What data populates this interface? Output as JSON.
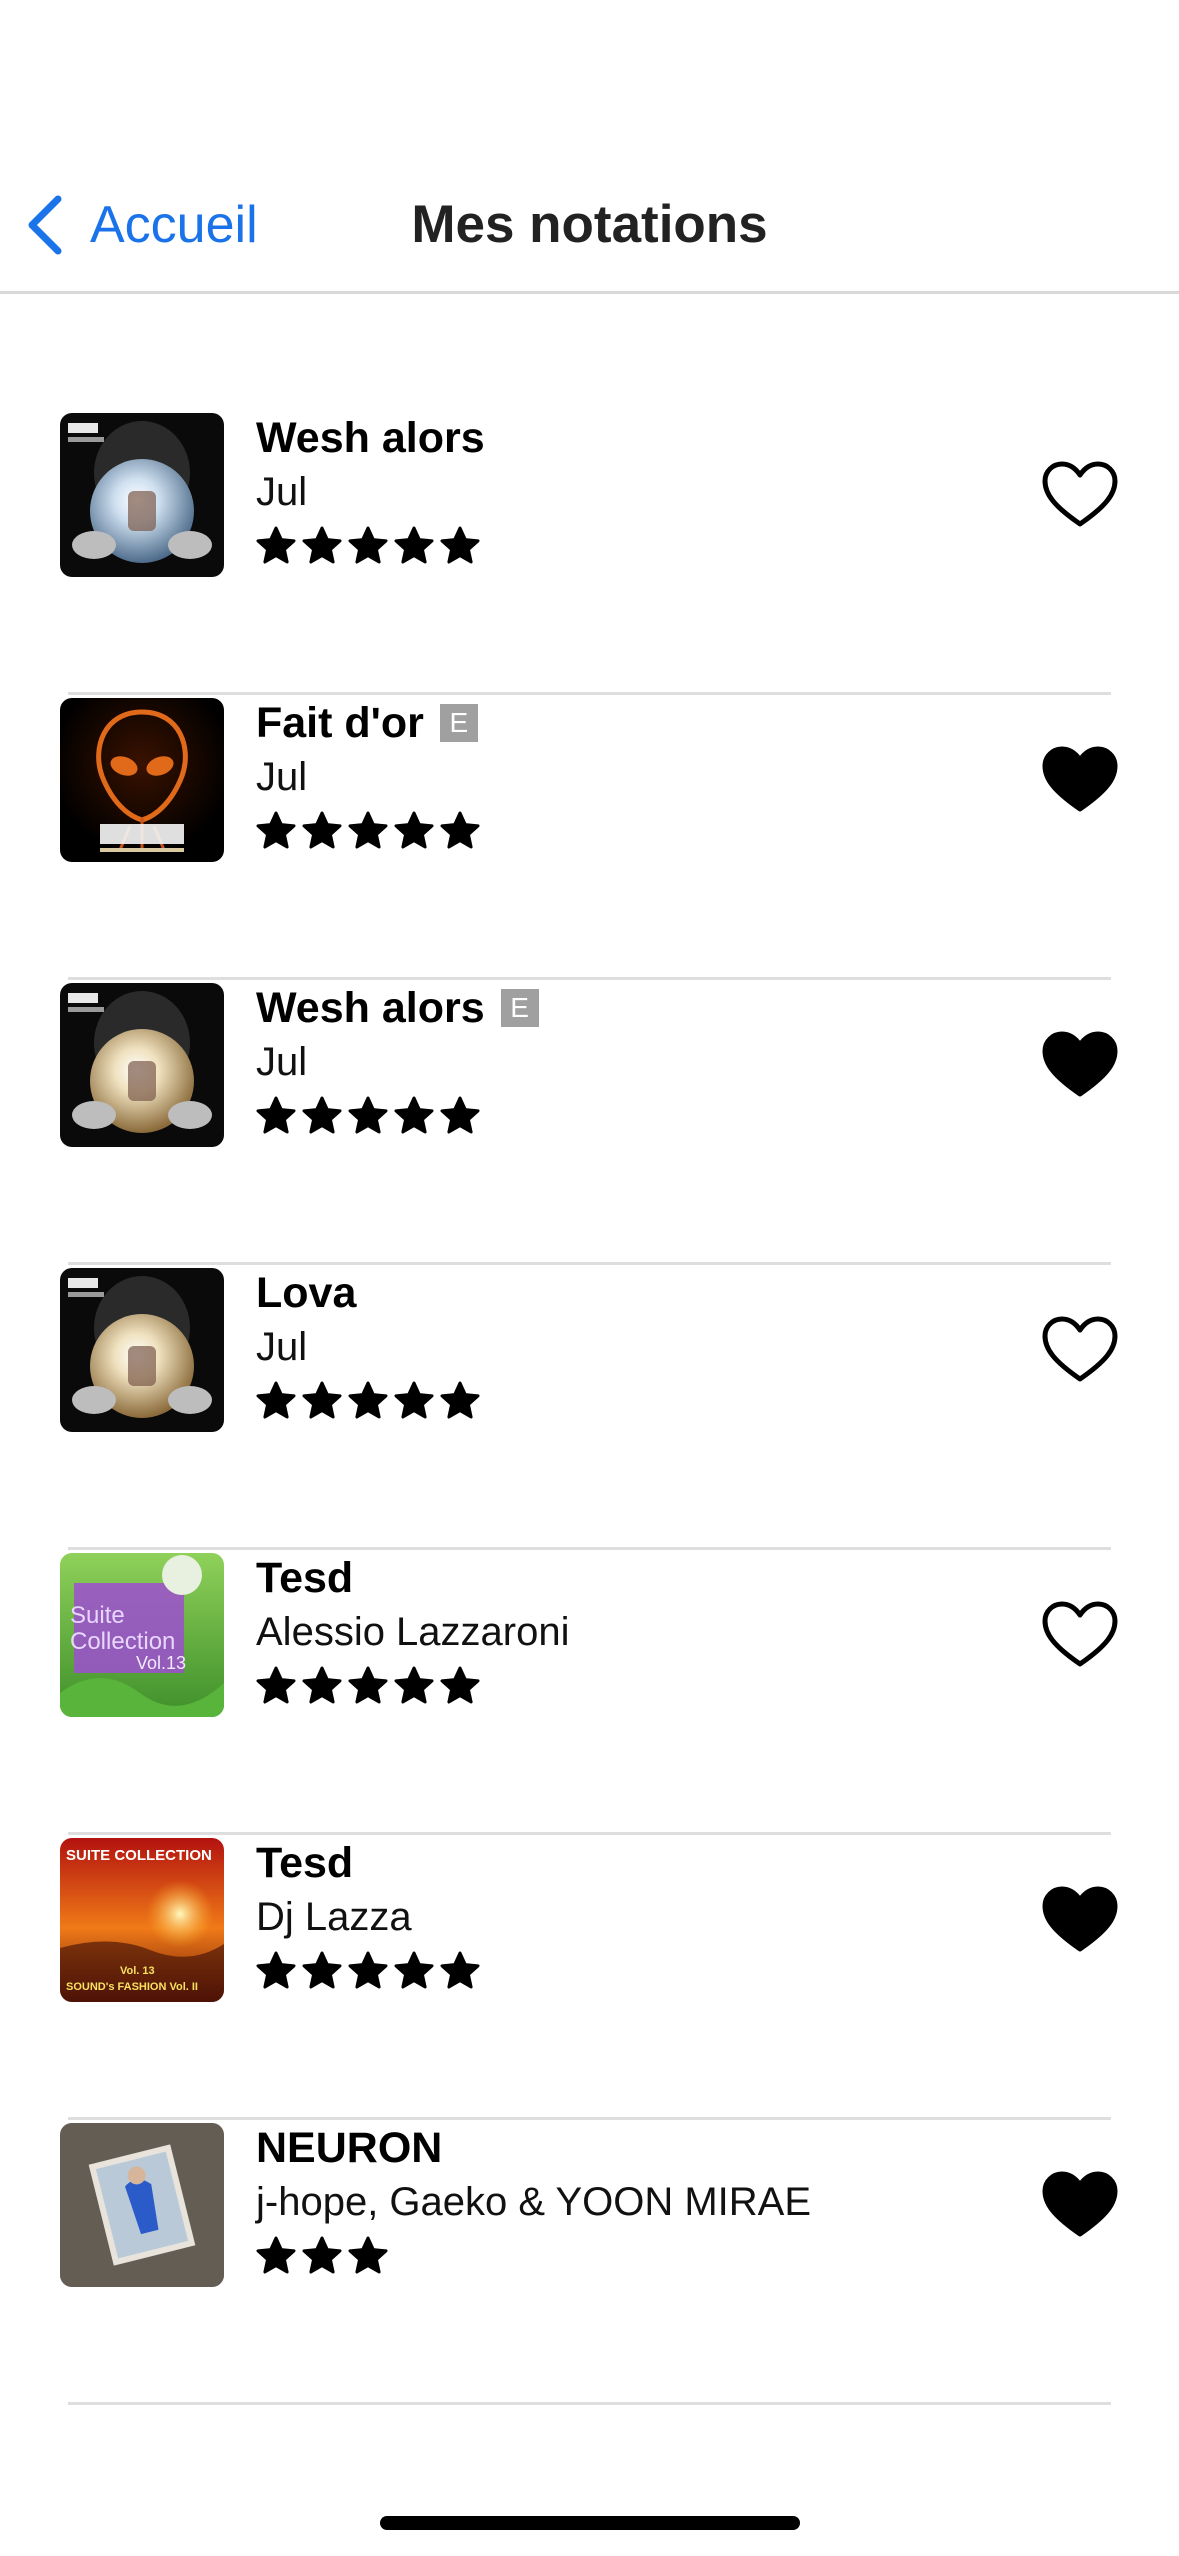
{
  "nav": {
    "back_label": "Accueil",
    "title": "Mes notations"
  },
  "accent_color": "#1a73e8",
  "items": [
    {
      "title": "Wesh alors",
      "explicit": false,
      "artist": "Jul",
      "rating": 5,
      "liked": false,
      "cover": "jul-crystal-ball-blue"
    },
    {
      "title": "Fait d'or",
      "explicit": true,
      "explicit_label": "E",
      "artist": "Jul",
      "rating": 5,
      "liked": true,
      "cover": "jul-alien-orange"
    },
    {
      "title": "Wesh alors",
      "explicit": true,
      "explicit_label": "E",
      "artist": "Jul",
      "rating": 5,
      "liked": true,
      "cover": "jul-crystal-ball-gold"
    },
    {
      "title": "Lova",
      "explicit": false,
      "artist": "Jul",
      "rating": 5,
      "liked": false,
      "cover": "jul-crystal-ball-gold"
    },
    {
      "title": "Tesd",
      "explicit": false,
      "artist": "Alessio Lazzaroni",
      "rating": 5,
      "liked": false,
      "cover": "suite-collection-green",
      "cover_text": "Suite Collection Vol.13"
    },
    {
      "title": "Tesd",
      "explicit": false,
      "artist": "Dj Lazza",
      "rating": 5,
      "liked": true,
      "cover": "suite-collection-sunset",
      "cover_text": "SUITE COLLECTION",
      "cover_subtext": "Vol. 13 SOUND's FASHION Vol. II"
    },
    {
      "title": "NEURON",
      "explicit": false,
      "artist": "j-hope, Gaeko & YOON MIRAE",
      "rating": 3,
      "liked": true,
      "cover": "hope-on-the-street"
    }
  ]
}
